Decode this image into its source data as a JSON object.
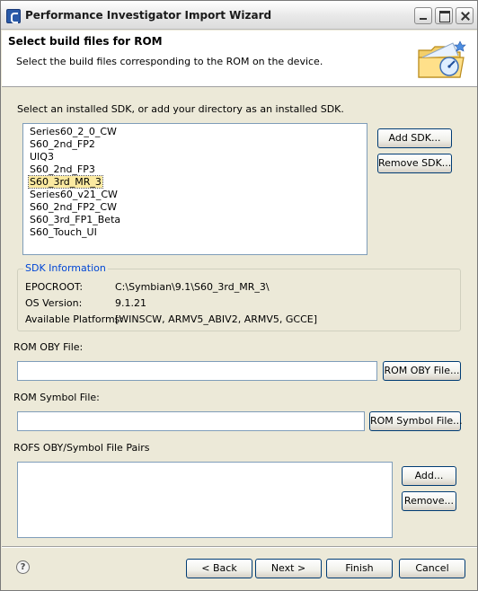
{
  "window": {
    "title": "Performance Investigator Import Wizard"
  },
  "header": {
    "title": "Select build files for ROM",
    "description": "Select the build files corresponding to the ROM on the device."
  },
  "sdk": {
    "instruction": "Select an installed SDK, or add your directory as an installed SDK.",
    "items": [
      "Series60_2_0_CW",
      "S60_2nd_FP2",
      "UIQ3",
      "S60_2nd_FP3",
      "S60_3rd_MR_3",
      "Series60_v21_CW",
      "S60_2nd_FP2_CW",
      "S60_3rd_FP1_Beta",
      "S60_Touch_UI"
    ],
    "selected": "S60_3rd_MR_3",
    "add_label": "Add SDK...",
    "remove_label": "Remove SDK..."
  },
  "sdk_info": {
    "legend": "SDK Information",
    "epocroot_label": "EPOCROOT:",
    "epocroot_value": "C:\\Symbian\\9.1\\S60_3rd_MR_3\\",
    "os_label": "OS Version:",
    "os_value": "9.1.21",
    "platforms_label": "Available Platforms:",
    "platforms_value": "[WINSCW, ARMV5_ABIV2, ARMV5, GCCE]"
  },
  "rom_oby": {
    "label": "ROM OBY File:",
    "value": "",
    "button": "ROM OBY File..."
  },
  "rom_symbol": {
    "label": "ROM Symbol File:",
    "value": "",
    "button": "ROM Symbol File..."
  },
  "rofs": {
    "label": "ROFS OBY/Symbol File Pairs",
    "add_label": "Add...",
    "remove_label": "Remove..."
  },
  "footer": {
    "help_glyph": "?",
    "back_label": "< Back",
    "next_label": "Next >",
    "finish_label": "Finish",
    "cancel_label": "Cancel"
  },
  "colors": {
    "accent": "#0046d5",
    "selection": "#fbe9a0",
    "face": "#ece9d8"
  },
  "icons": [
    "app-icon",
    "minimize-icon",
    "maximize-icon",
    "close-icon",
    "wizard-folder-icon",
    "help-icon"
  ]
}
